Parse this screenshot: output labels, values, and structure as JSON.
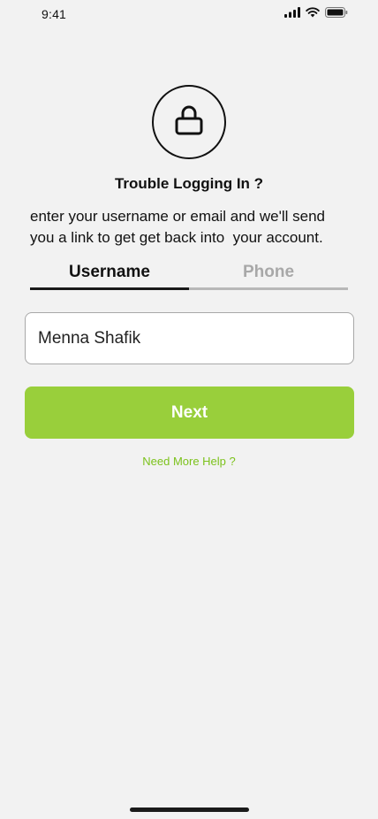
{
  "status_bar": {
    "time": "9:41",
    "icons": [
      "signal-icon",
      "wifi-icon",
      "battery-icon"
    ]
  },
  "header": {
    "icon": "lock-icon",
    "title": "Trouble Logging In ?",
    "description": "enter your username or email and we'll send\nyou a link to get get back into  your account."
  },
  "tabs": [
    {
      "label": "Username",
      "active": true
    },
    {
      "label": "Phone",
      "active": false
    }
  ],
  "form": {
    "username_value": "Menna Shafik",
    "next_label": "Next"
  },
  "help": {
    "label": "Need More Help ?"
  },
  "colors": {
    "background": "#f2f2f2",
    "accent": "#99cf3b",
    "link": "#7cc21c",
    "inactive_tab": "#a8a8a8"
  }
}
